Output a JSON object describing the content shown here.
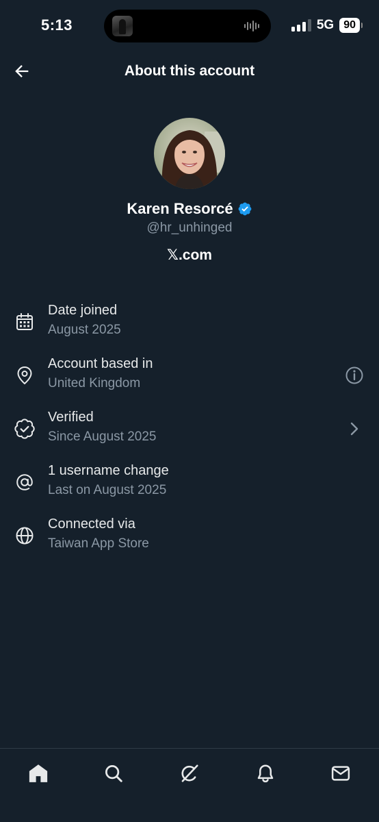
{
  "status_bar": {
    "time": "5:13",
    "network": "5G",
    "battery": "90"
  },
  "header": {
    "back_icon": "back-arrow-icon",
    "title": "About this account"
  },
  "profile": {
    "display_name": "Karen Resorcé",
    "handle": "@hr_unhinged",
    "verified_badge_color": "#1d9bf0",
    "site_logo": "𝕏",
    "site_suffix": ".com"
  },
  "info_items": [
    {
      "icon": "calendar-icon",
      "title": "Date joined",
      "subtitle": "August 2025"
    },
    {
      "icon": "location-pin-icon",
      "title": "Account based in",
      "subtitle": "United Kingdom",
      "action_icon": "info-icon"
    },
    {
      "icon": "verified-badge-icon",
      "title": "Verified",
      "subtitle": "Since August 2025",
      "action_icon": "chevron-right-icon"
    },
    {
      "icon": "at-sign-icon",
      "title": "1 username change",
      "subtitle": "Last on August 2025"
    },
    {
      "icon": "globe-icon",
      "title": "Connected via",
      "subtitle": "Taiwan App Store"
    }
  ],
  "bottom_nav": [
    "home-icon",
    "search-icon",
    "grok-icon",
    "notifications-icon",
    "messages-icon"
  ],
  "colors": {
    "background": "#15202b",
    "text_primary": "#e7e9ea",
    "text_secondary": "#8b98a5",
    "accent": "#1d9bf0"
  }
}
